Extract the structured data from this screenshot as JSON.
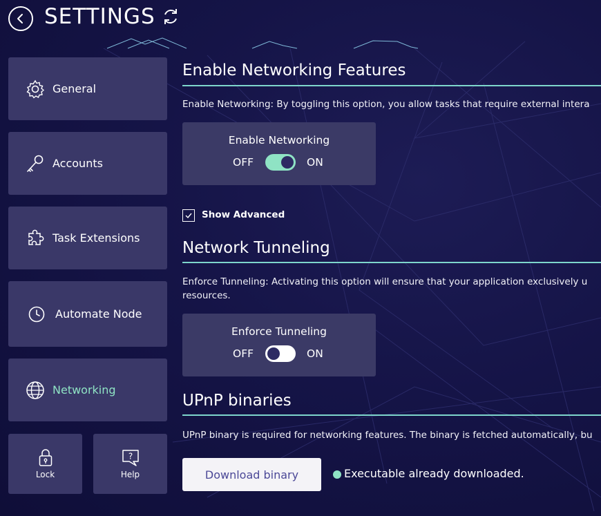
{
  "header": {
    "title": "SETTINGS",
    "back_icon": "back-arrow-icon",
    "refresh_icon": "refresh-icon"
  },
  "sidebar": {
    "items": [
      {
        "label": "General",
        "icon": "gear-icon",
        "active": false
      },
      {
        "label": "Accounts",
        "icon": "key-icon",
        "active": false
      },
      {
        "label": "Task Extensions",
        "icon": "puzzle-icon",
        "active": false
      },
      {
        "label": "Automate Node",
        "icon": "clock-icon",
        "active": false
      },
      {
        "label": "Networking",
        "icon": "globe-icon",
        "active": true
      }
    ],
    "lock_label": "Lock",
    "help_label": "Help"
  },
  "networking": {
    "title": "Enable Networking Features",
    "description": "Enable Networking: By toggling this option, you allow tasks that require external intera",
    "toggle": {
      "label": "Enable Networking",
      "off": "OFF",
      "on": "ON",
      "state": "on"
    }
  },
  "advanced": {
    "label": "Show Advanced",
    "checked": true
  },
  "tunneling": {
    "title": "Network Tunneling",
    "description_line1": "Enforce Tunneling: Activating this option will ensure that your application exclusively u",
    "description_line2": "resources.",
    "toggle": {
      "label": "Enforce Tunneling",
      "off": "OFF",
      "on": "ON",
      "state": "off"
    }
  },
  "upnp": {
    "title": "UPnP binaries",
    "description": "UPnP binary is required for networking features. The binary is fetched automatically, bu",
    "download_label": "Download binary",
    "status": "Executable already downloaded."
  },
  "colors": {
    "background": "#131242",
    "card": "#3a3868",
    "accent": "#8fe3c4",
    "rule": "#7ed6cc"
  }
}
